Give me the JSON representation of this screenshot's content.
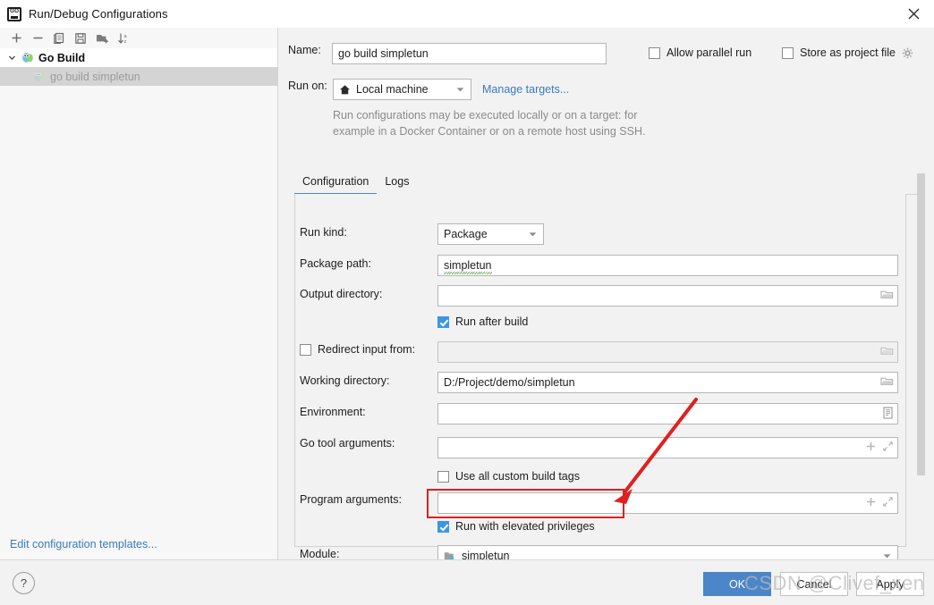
{
  "window": {
    "title": "Run/Debug Configurations",
    "app_icon": "go-logo-icon",
    "close_label": "×"
  },
  "sidebar": {
    "toolbar": [
      {
        "name": "add-button",
        "icon": "plus-icon",
        "label": "+"
      },
      {
        "name": "remove-button",
        "icon": "minus-icon",
        "label": "−"
      },
      {
        "name": "copy-button",
        "icon": "copy-icon",
        "label": "copy"
      },
      {
        "name": "save-button",
        "icon": "save-icon",
        "label": "save"
      },
      {
        "name": "move-to-folder-button",
        "icon": "folder-add-icon",
        "label": "folder"
      },
      {
        "name": "sort-button",
        "icon": "sort-alpha-icon",
        "label": "sort"
      }
    ],
    "tree": [
      {
        "label": "Go Build",
        "icon": "gopher-icon",
        "expanded": true,
        "level": 0
      },
      {
        "label": "go build simpletun",
        "icon": "gopher-icon",
        "selected": true,
        "level": 1
      }
    ],
    "edit_templates_link": "Edit configuration templates..."
  },
  "form": {
    "name_label": "Name:",
    "name_value": "go build simpletun",
    "allow_parallel_run_label": "Allow parallel run",
    "allow_parallel_run_checked": false,
    "store_as_project_file_label": "Store as project file",
    "store_as_project_file_checked": false,
    "store_gear_icon": "gear-icon",
    "run_on_label": "Run on:",
    "run_on_value": "Local machine",
    "run_on_icon": "home-icon",
    "manage_targets_link": "Manage targets...",
    "hint_line1": "Run configurations may be executed locally or on a target: for",
    "hint_line2": "example in a Docker Container or on a remote host using SSH.",
    "tabs": [
      {
        "label": "Configuration",
        "active": true
      },
      {
        "label": "Logs",
        "active": false
      }
    ],
    "fields": {
      "run_kind_label": "Run kind:",
      "run_kind_value": "Package",
      "package_path_label": "Package path:",
      "package_path_value": "simpletun",
      "output_directory_label": "Output directory:",
      "output_directory_value": "",
      "run_after_build_label": "Run after build",
      "run_after_build_checked": true,
      "redirect_input_label": "Redirect input from:",
      "redirect_input_checked": false,
      "redirect_input_value": "",
      "working_directory_label": "Working directory:",
      "working_directory_value": "D:/Project/demo/simpletun",
      "environment_label": "Environment:",
      "environment_value": "",
      "go_tool_arguments_label": "Go tool arguments:",
      "go_tool_arguments_value": "",
      "use_all_custom_build_tags_label": "Use all custom build tags",
      "use_all_custom_build_tags_checked": false,
      "program_arguments_label": "Program arguments:",
      "program_arguments_value": "",
      "run_with_elevated_privileges_label": "Run with elevated privileges",
      "run_with_elevated_privileges_checked": true,
      "module_label": "Module:",
      "module_value": "simpletun",
      "module_icon": "module-folder-icon"
    }
  },
  "buttons": {
    "help_label": "?",
    "ok_label": "OK",
    "cancel_label": "Cancel",
    "apply_label": "Apply"
  },
  "watermark": {
    "text": "CSDN @Clivef_xen"
  },
  "annotations": {
    "highlight_color": "#e02020",
    "highlight_target": "run-with-elevated-privileges-checkbox"
  },
  "colors": {
    "accent_blue": "#4a86c8",
    "tab_underline": "#4a88c7",
    "link": "#3a7bc0",
    "checkbox_checked": "#3b97e3",
    "annotation_red": "#e02020"
  }
}
